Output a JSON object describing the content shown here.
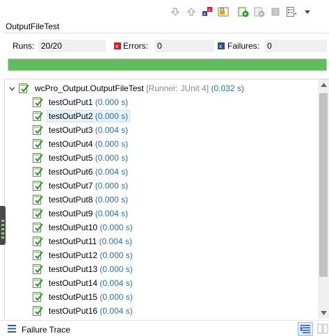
{
  "title": "OutputFileTest",
  "counters": {
    "runs_label": "Runs:",
    "runs_value": "20/20",
    "errors_label": "Errors:",
    "errors_value": "0",
    "failures_label": "Failures:",
    "failures_value": "0"
  },
  "progress": {
    "fraction": 1.0,
    "color": "#5fbd5b"
  },
  "toolbar": [
    "next-failure-icon",
    "previous-failure-icon",
    "show-failures-only-icon",
    "scroll-lock-icon",
    "rerun-test-icon",
    "rerun-failed-first-icon",
    "stop-icon",
    "test-run-history-icon",
    "view-menu-icon"
  ],
  "tree": {
    "root": {
      "name": "wcPro_Output.OutputFileTest",
      "runner": "[Runner: JUnit 4]",
      "time": "(0.032 s)"
    },
    "items": [
      {
        "name": "testOutPut1",
        "time": "(0.000 s)"
      },
      {
        "name": "testOutPut2",
        "time": "(0.000 s)"
      },
      {
        "name": "testOutPut3",
        "time": "(0.004 s)"
      },
      {
        "name": "testOutPut4",
        "time": "(0.000 s)"
      },
      {
        "name": "testOutPut5",
        "time": "(0.000 s)"
      },
      {
        "name": "testOutPut6",
        "time": "(0.004 s)"
      },
      {
        "name": "testOutPut7",
        "time": "(0.000 s)"
      },
      {
        "name": "testOutPut8",
        "time": "(0.000 s)"
      },
      {
        "name": "testOutPut9",
        "time": "(0.004 s)"
      },
      {
        "name": "testOutPut10",
        "time": "(0.000 s)"
      },
      {
        "name": "testOutPut11",
        "time": "(0.004 s)"
      },
      {
        "name": "testOutPut12",
        "time": "(0.000 s)"
      },
      {
        "name": "testOutPut13",
        "time": "(0.000 s)"
      },
      {
        "name": "testOutPut14",
        "time": "(0.004 s)"
      },
      {
        "name": "testOutPut15",
        "time": "(0.000 s)"
      },
      {
        "name": "testOutPut16",
        "time": "(0.004 s)"
      }
    ],
    "selected_index": 1
  },
  "bottom": {
    "failure_trace_label": "Failure Trace"
  },
  "colors": {
    "accent_time": "#2e6fa7",
    "selection": "#e5f1fb",
    "progress_green": "#5fbd5b"
  }
}
